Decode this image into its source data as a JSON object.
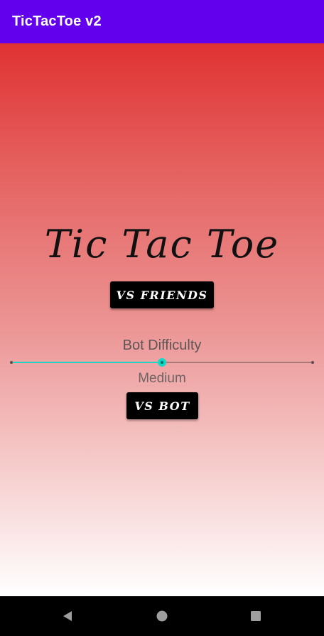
{
  "app_bar": {
    "title": "TicTacToe v2",
    "color": "#6200ee"
  },
  "main": {
    "game_title": "Tic Tac Toe",
    "vs_friends_label": "VS FRIENDS",
    "difficulty": {
      "label": "Bot Difficulty",
      "value_label": "Medium",
      "slider_fraction": 0.5,
      "accent_color": "#03dac5"
    },
    "vs_bot_label": "VS BOT",
    "gradient_colors": [
      "#e03232",
      "#ffffff"
    ]
  },
  "nav_bar": {
    "icons": [
      "back-triangle-icon",
      "home-circle-icon",
      "recents-square-icon"
    ]
  }
}
